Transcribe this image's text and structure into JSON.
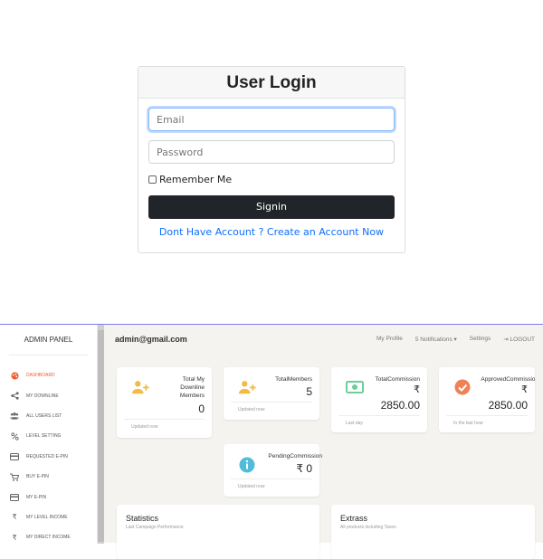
{
  "login": {
    "title": "User Login",
    "email_placeholder": "Email",
    "password_placeholder": "Password",
    "remember_label": "Remember Me",
    "signin_label": "Signin",
    "create_link": "Dont Have Account ? Create an Account Now"
  },
  "admin": {
    "sidebar_title": "ADMIN PANEL",
    "nav": [
      {
        "label": "DASHBOARD",
        "icon": "palette-icon"
      },
      {
        "label": "MY DOWNLINE",
        "icon": "share-icon"
      },
      {
        "label": "ALL USERS LIST",
        "icon": "users-icon"
      },
      {
        "label": "LEVEL SETTING",
        "icon": "percent-icon"
      },
      {
        "label": "REQUESTED E-PIN",
        "icon": "credit-card-icon"
      },
      {
        "label": "BUY E-PIN",
        "icon": "cart-icon"
      },
      {
        "label": "MY E-PIN",
        "icon": "credit-card-icon"
      },
      {
        "label": "MY LEVEL INCOME",
        "icon": "rupee-icon"
      },
      {
        "label": "MY DIRECT INCOME",
        "icon": "rupee-icon"
      }
    ],
    "user_email": "admin@gmail.com",
    "topbar": {
      "profile": "My Profile",
      "notifications": "5 Notifications ▾",
      "settings": "Settings",
      "logout": "⇥ LOGOUT"
    },
    "cards": [
      {
        "label1": "Total My",
        "label2": "Downline",
        "label3": "Members",
        "value": "0",
        "foot": "Updated now",
        "icon": "add-user-icon"
      },
      {
        "label1": "TotalMembers",
        "value": "5",
        "foot": "Updated now",
        "icon": "add-user-icon"
      },
      {
        "label1": "TotalCommission",
        "currency": "₹",
        "value": "2850.00",
        "foot": "Last day",
        "icon": "money-icon"
      },
      {
        "label1": "ApprovedCommission",
        "currency": "₹",
        "value": "2850.00",
        "foot": "In the last hour",
        "icon": "check-icon"
      },
      {
        "label1": "PendingCommission",
        "value": "₹ 0",
        "foot": "Updated now",
        "icon": "info-icon"
      }
    ],
    "panels": [
      {
        "title": "Statistics",
        "subtitle": "Last Campaign Performance"
      },
      {
        "title": "Extrass",
        "subtitle": "All products including Taxes"
      }
    ],
    "colors": {
      "accent": "#ef5b2b",
      "warning": "#f3bb45",
      "success": "#6bd098",
      "info": "#51bcda",
      "danger": "#ef8157"
    }
  }
}
